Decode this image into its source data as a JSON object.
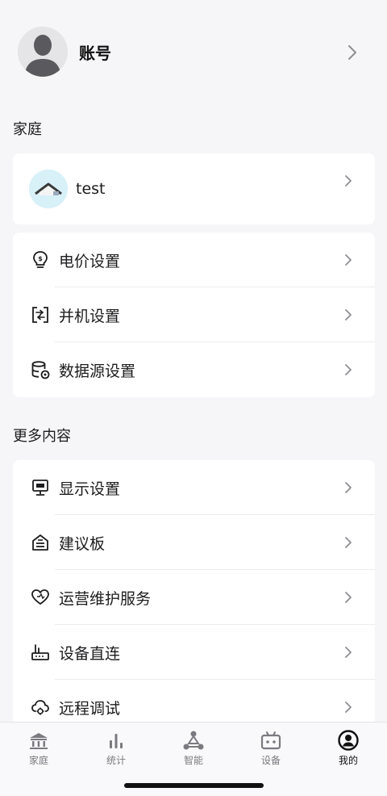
{
  "account": {
    "name": "账号",
    "avatar_icon": "user-avatar-icon"
  },
  "family_section": {
    "title": "家庭"
  },
  "home": {
    "name": "test"
  },
  "settings": {
    "items": [
      {
        "label": "电价设置",
        "icon": "price-bulb-icon"
      },
      {
        "label": "并机设置",
        "icon": "parallel-machine-icon"
      },
      {
        "label": "数据源设置",
        "icon": "data-source-icon"
      }
    ]
  },
  "more_section": {
    "title": "更多内容"
  },
  "more": {
    "items": [
      {
        "label": "显示设置",
        "icon": "monitor-icon"
      },
      {
        "label": "建议板",
        "icon": "suggestion-box-icon"
      },
      {
        "label": "运营维护服务",
        "icon": "maintenance-heart-icon"
      },
      {
        "label": "设备直连",
        "icon": "device-connect-icon"
      },
      {
        "label": "远程调试",
        "icon": "cloud-gear-icon"
      }
    ]
  },
  "tabbar": {
    "tabs": [
      {
        "label": "家庭",
        "icon": "home-icon"
      },
      {
        "label": "统计",
        "icon": "stats-icon"
      },
      {
        "label": "智能",
        "icon": "smart-icon"
      },
      {
        "label": "设备",
        "icon": "device-icon"
      },
      {
        "label": "我的",
        "icon": "profile-icon",
        "active": true
      }
    ]
  },
  "colors": {
    "background": "#f6f6f9",
    "card": "#ffffff",
    "text": "#1c1c1e",
    "muted": "#7a7a80",
    "chevron": "#8e8e93"
  }
}
